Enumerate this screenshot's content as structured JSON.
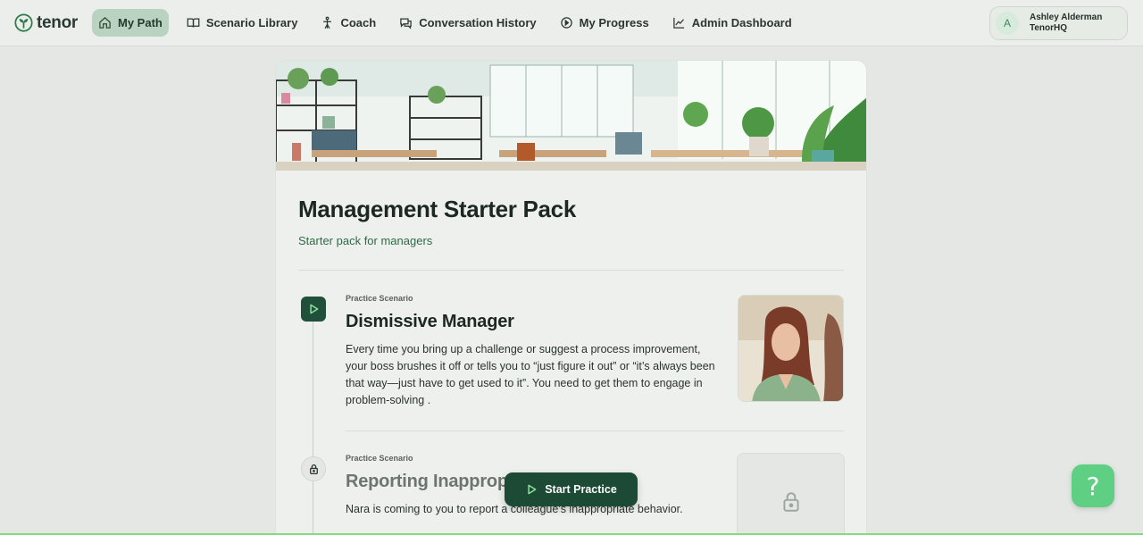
{
  "app": {
    "name": "tenor"
  },
  "nav": {
    "items": [
      {
        "label": "My Path",
        "icon": "home-icon",
        "active": true
      },
      {
        "label": "Scenario Library",
        "icon": "book-icon"
      },
      {
        "label": "Coach",
        "icon": "coach-icon"
      },
      {
        "label": "Conversation History",
        "icon": "chat-icon"
      },
      {
        "label": "My Progress",
        "icon": "progress-icon"
      },
      {
        "label": "Admin Dashboard",
        "icon": "chart-line-icon"
      }
    ]
  },
  "user": {
    "initial": "A",
    "name": "Ashley Alderman",
    "org": "TenorHQ"
  },
  "path": {
    "title": "Management Starter Pack",
    "subtitle": "Starter pack for managers",
    "scenarios": [
      {
        "kicker": "Practice Scenario",
        "title": "Dismissive Manager",
        "description": "Every time you bring up a challenge or suggest a process improvement, your boss brushes it off or tells you to “just figure it out” or “it’s always been that way—just have to get used to it”. You need to get them to engage in problem-solving .",
        "status": "play"
      },
      {
        "kicker": "Practice Scenario",
        "title": "Reporting Inappropri",
        "description": "Nara is coming to you to report a colleague's inappropriate behavior.",
        "status": "locked"
      }
    ]
  },
  "actions": {
    "start_practice": "Start Practice",
    "help": "?"
  },
  "colors": {
    "accent": "#1d4a35",
    "active_nav": "#b9d3c0",
    "help": "#5fd083"
  }
}
